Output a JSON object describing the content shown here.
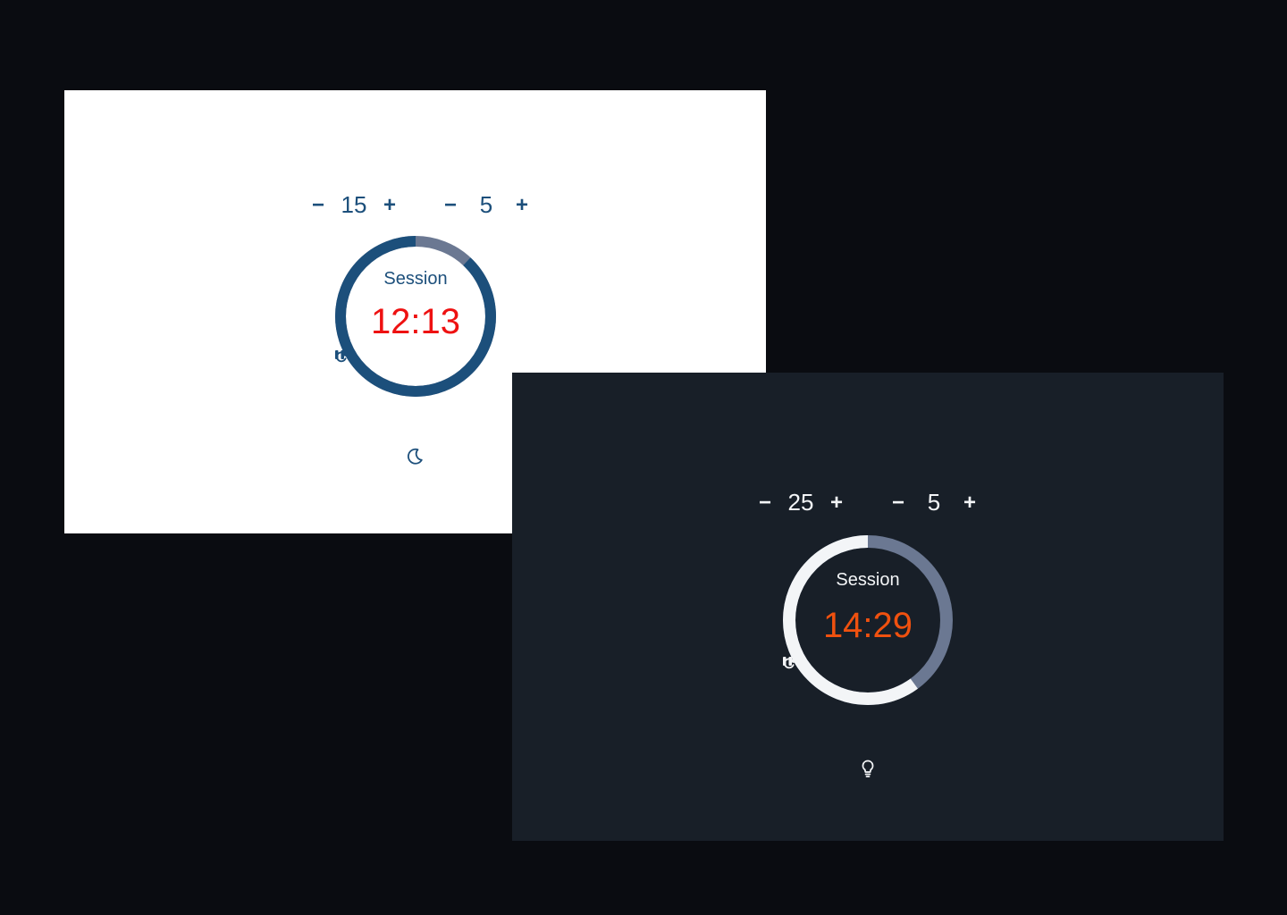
{
  "colors": {
    "background": "#0a0c11",
    "light_panel_bg": "#ffffff",
    "light_accent": "#1c4f7b",
    "light_time": "#ee1111",
    "dark_panel_bg": "#181f28",
    "dark_accent": "#f3f5f7",
    "dark_time": "#f0510f",
    "track": "#6b7892"
  },
  "light": {
    "session_minus": "−",
    "session_length": "15",
    "session_plus": "+",
    "break_minus": "−",
    "break_length": "5",
    "break_plus": "+",
    "label": "Session",
    "time": "12:13",
    "remaining_fraction": 0.88,
    "pause_icon": "pause-icon",
    "reset_icon": "refresh-icon",
    "theme_icon": "moon-icon"
  },
  "dark": {
    "session_minus": "−",
    "session_length": "25",
    "session_plus": "+",
    "break_minus": "−",
    "break_length": "5",
    "break_plus": "+",
    "label": "Session",
    "time": "14:29",
    "remaining_fraction": 0.6,
    "pause_icon": "pause-icon",
    "reset_icon": "refresh-icon",
    "theme_icon": "lightbulb-icon"
  }
}
